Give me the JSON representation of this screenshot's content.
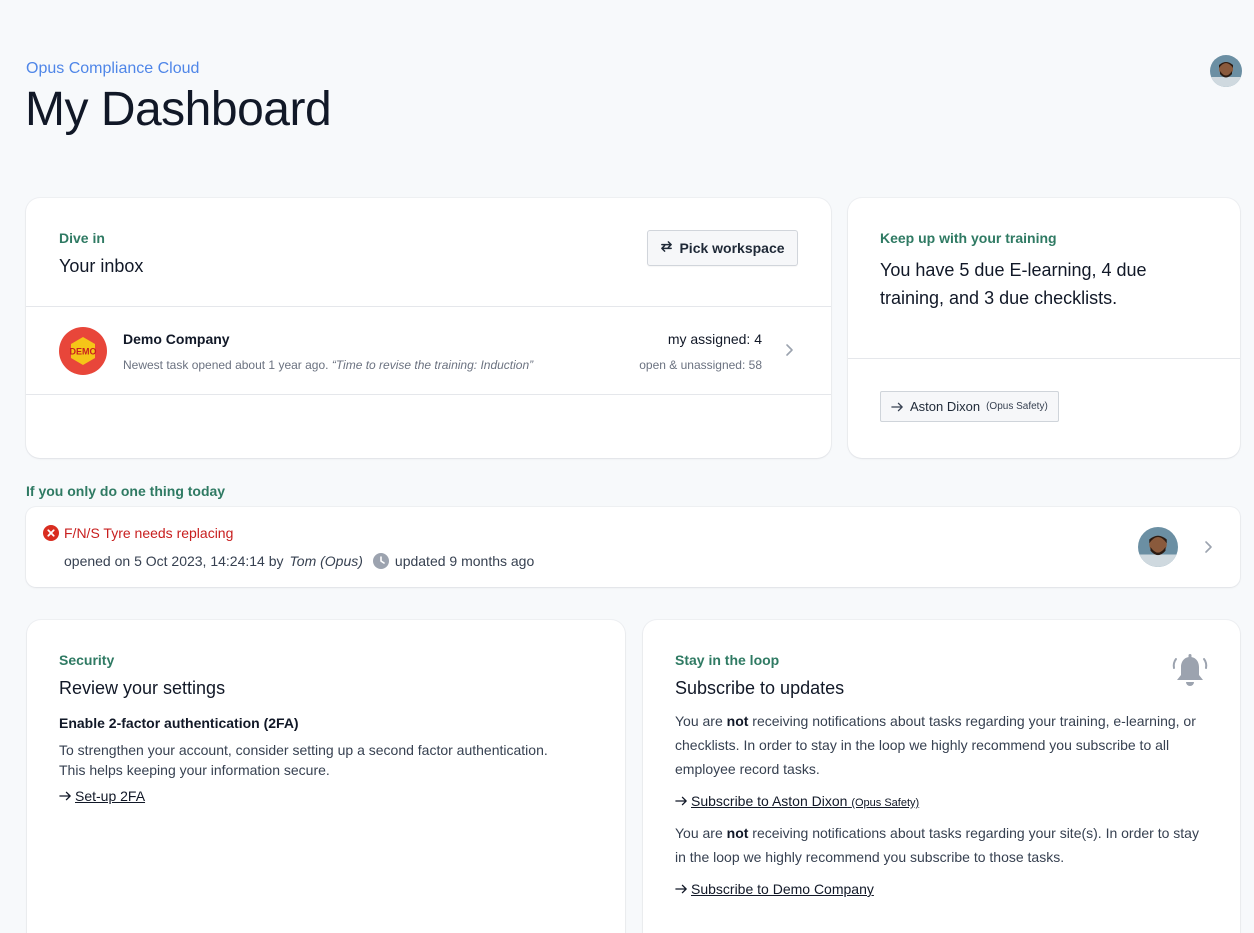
{
  "header": {
    "app_name": "Opus Compliance Cloud",
    "page_title": "My Dashboard"
  },
  "inbox": {
    "eyebrow": "Dive in",
    "title": "Your inbox",
    "pick_workspace_label": "Pick workspace",
    "rows": [
      {
        "logo_text": "DEMO",
        "company": "Demo Company",
        "newest_prefix": "Newest task opened about 1 year ago.",
        "newest_quote": "“Time to revise the training: Induction”",
        "my_assigned": "my assigned: 4",
        "open_unassigned": "open & unassigned: 58"
      }
    ]
  },
  "training": {
    "eyebrow": "Keep up with your training",
    "title": "You have 5 due E-learning, 4 due training, and 3 due checklists.",
    "person_name": "Aston Dixon",
    "person_org": "(Opus Safety)"
  },
  "today": {
    "label": "If you only do one thing today",
    "task_title": "F/N/S Tyre needs replacing",
    "opened_prefix": "opened on 5 Oct 2023, 14:24:14 by",
    "opened_by": "Tom (Opus)",
    "updated": "updated 9 months ago"
  },
  "security": {
    "eyebrow": "Security",
    "title": "Review your settings",
    "subheading": "Enable 2-factor authentication (2FA)",
    "body_line1": "To strengthen your account, consider setting up a second factor authentication.",
    "body_line2": "This helps keeping your information secure.",
    "link_label": "Set-up 2FA"
  },
  "loop": {
    "eyebrow": "Stay in the loop",
    "title": "Subscribe to updates",
    "p1_pre": "You are",
    "p1_bold": "not",
    "p1_post": "receiving notifications about tasks regarding your training, e-learning, or checklists. In order to stay in the loop we highly recommend you subscribe to all employee record tasks.",
    "link1_label": "Subscribe to Aston Dixon",
    "link1_small": "(Opus Safety)",
    "p2_pre": "You are",
    "p2_bold": "not",
    "p2_post": "receiving notifications about tasks regarding your site(s). In order to stay in the loop we highly recommend you subscribe to those tasks.",
    "link2_label": "Subscribe to Demo Company"
  },
  "colors": {
    "accent_blue": "#4f86e8",
    "eyebrow_green": "#2f7a63",
    "alert_red": "#c81e1e",
    "demo_logo_red": "#e8463a",
    "demo_logo_yellow": "#f5c518"
  },
  "icons": [
    "avatar",
    "swap-arrows-icon",
    "demo-company-logo",
    "chevron-right-icon",
    "arrow-right-icon",
    "error-circle-icon",
    "clock-icon",
    "bell-icon"
  ]
}
